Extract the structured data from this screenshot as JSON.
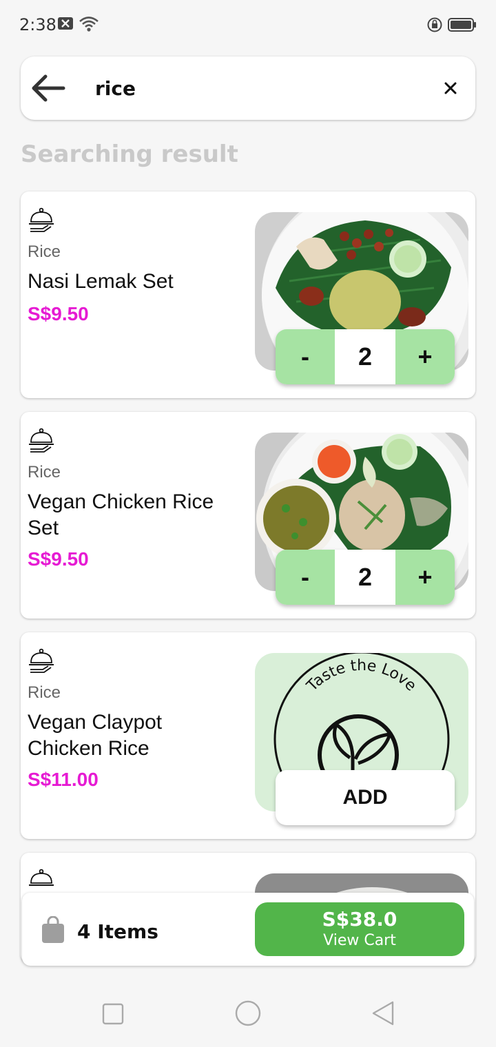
{
  "status_bar": {
    "time": "2:38",
    "icons": [
      "notification-x-icon",
      "wifi-icon",
      "rotation-lock-icon",
      "battery-icon"
    ]
  },
  "search": {
    "query": "rice",
    "back_icon": "arrow-left-icon",
    "clear_icon": "close-icon"
  },
  "section_title": "Searching result",
  "colors": {
    "price": "#e61bd3",
    "qty_button": "#a6e3a3",
    "cart_button": "#52b54a",
    "section_title": "#c9c9c9"
  },
  "results": [
    {
      "category": "Rice",
      "name": "Nasi Lemak Set",
      "price": "S$9.50",
      "quantity": "2",
      "minus": "-",
      "plus": "+"
    },
    {
      "category": "Rice",
      "name": "Vegan Chicken Rice Set",
      "price": "S$9.50",
      "quantity": "2",
      "minus": "-",
      "plus": "+"
    },
    {
      "category": "Rice",
      "name": "Vegan Claypot Chicken Rice",
      "price": "S$11.00",
      "add_label": "ADD",
      "logo_text": "Taste the Love"
    }
  ],
  "cart": {
    "items_label": "4 Items",
    "total": "S$38.0",
    "view_cart_label": "View Cart"
  },
  "nav_bar": {
    "icons": [
      "recents-square-icon",
      "home-circle-icon",
      "back-triangle-icon"
    ]
  }
}
